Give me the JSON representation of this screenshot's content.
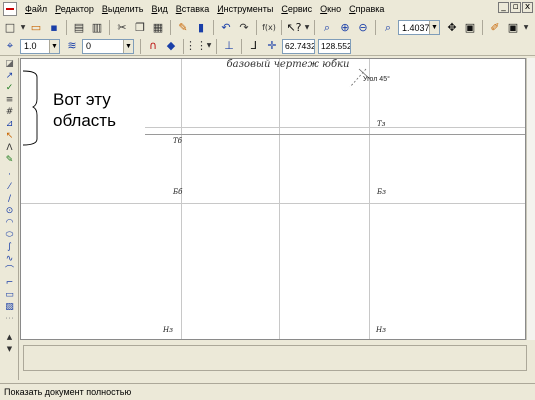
{
  "menu": {
    "items": [
      {
        "u": "Ф",
        "rest": "айл"
      },
      {
        "u": "Р",
        "rest": "едактор"
      },
      {
        "u": "В",
        "rest": "ыделить"
      },
      {
        "u": "В",
        "rest": "ид"
      },
      {
        "u": "В",
        "rest": "ставка"
      },
      {
        "u": "И",
        "rest": "нструменты"
      },
      {
        "u": "С",
        "rest": "ервис"
      },
      {
        "u": "О",
        "rest": "кно"
      },
      {
        "u": "С",
        "rest": "правка"
      }
    ],
    "window_controls": [
      "_",
      "▫",
      "x"
    ]
  },
  "toolbar": {
    "zoom_value": "1.4037",
    "line_width": "1.0",
    "layer": "0",
    "coord_x": "62.7432",
    "coord_y": "128.552"
  },
  "drawing": {
    "title": "базовый чертеж юбки",
    "angle": "Угол 45°",
    "labels": {
      "tb": "Тб",
      "tz": "Тз",
      "bb": "Бб",
      "bz": "Бз",
      "nb": "Нз",
      "nz": "Нз"
    }
  },
  "callout": {
    "line1": "Вот эту",
    "line2": "область"
  },
  "status": {
    "text": "Показать документ полностью"
  },
  "colors": {
    "chrome": "#ece9d8",
    "canvas": "#ffffff",
    "grid_line": "#c8c8c8"
  }
}
